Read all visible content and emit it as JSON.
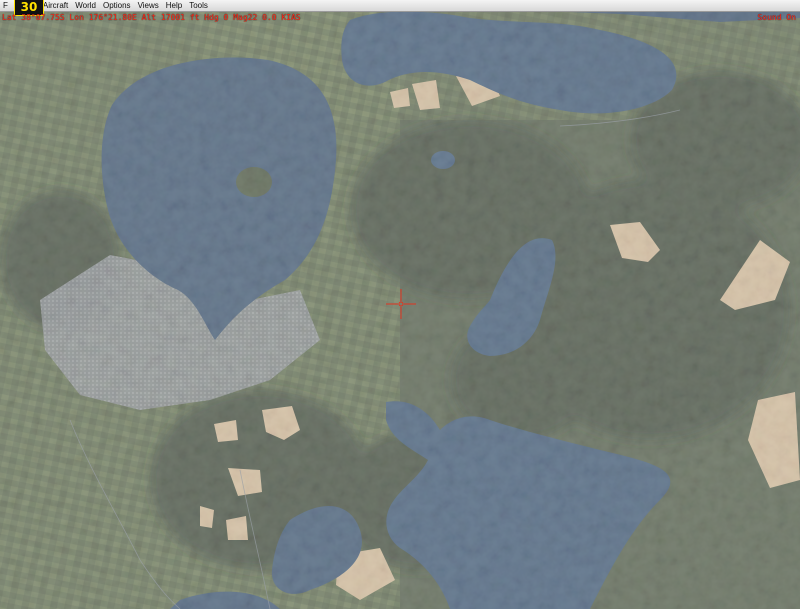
{
  "window": {
    "fps": "30"
  },
  "menu": {
    "items": [
      {
        "label": "F",
        "name": "menu-file"
      },
      {
        "label": "Aircraft",
        "name": "menu-aircraft"
      },
      {
        "label": "World",
        "name": "menu-world"
      },
      {
        "label": "Options",
        "name": "menu-options"
      },
      {
        "label": "Views",
        "name": "menu-views"
      },
      {
        "label": "Help",
        "name": "menu-help"
      },
      {
        "label": "Tools",
        "name": "menu-tools"
      }
    ]
  },
  "status": {
    "left": "Lat 38°07.75S  Lon 176°21.80E  Alt 17001 ft  Hdg 0  Mag22 0.0 KIAS",
    "right": "Sound On"
  },
  "colors": {
    "water": "#1f3c5c",
    "water_deep": "#18314d",
    "land_dark": "#273220",
    "land_mid": "#3d4a2e",
    "land_light": "#55623c",
    "field": "#c8ad84",
    "town": "#767a80",
    "overlay_text": "#ff2a1a",
    "fps_text": "#ffe100"
  },
  "crosshair": {
    "icon": "crosshair-icon"
  }
}
